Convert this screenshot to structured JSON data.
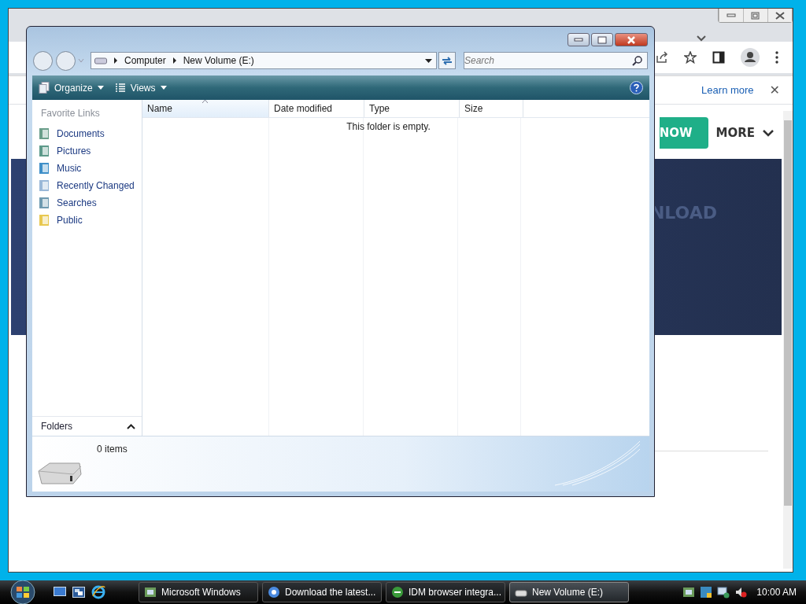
{
  "browser": {
    "info_bar": {
      "link": "Learn more",
      "close": "✕"
    },
    "nav": {
      "cta": "NOW",
      "more": "MORE"
    },
    "banner": {
      "text": "NLOAD"
    }
  },
  "explorer": {
    "breadcrumb": [
      "Computer",
      "New Volume (E:)"
    ],
    "search": {
      "placeholder": "Search"
    },
    "toolbar": [
      {
        "label": "Organize",
        "kind": "organize"
      },
      {
        "label": "Views",
        "kind": "views"
      }
    ],
    "favorites_title": "Favorite Links",
    "favorites": [
      {
        "label": "Documents",
        "kind": "documents"
      },
      {
        "label": "Pictures",
        "kind": "pictures"
      },
      {
        "label": "Music",
        "kind": "music"
      },
      {
        "label": "Recently Changed",
        "kind": "recent"
      },
      {
        "label": "Searches",
        "kind": "searches"
      },
      {
        "label": "Public",
        "kind": "folder"
      }
    ],
    "folders_label": "Folders",
    "columns": [
      {
        "label": "Name",
        "sorted": true
      },
      {
        "label": "Date modified",
        "sorted": false
      },
      {
        "label": "Type",
        "sorted": false
      },
      {
        "label": "Size",
        "sorted": false
      }
    ],
    "empty_message": "This folder is empty.",
    "status": "0 items"
  },
  "taskbar": {
    "tasks": [
      {
        "label": "Microsoft Windows",
        "kind": "app",
        "selected": false
      },
      {
        "label": "Download the latest...",
        "kind": "chrome",
        "selected": false
      },
      {
        "label": "IDM browser integra...",
        "kind": "idm",
        "selected": false
      },
      {
        "label": "New Volume (E:)",
        "kind": "drive",
        "selected": true
      }
    ],
    "clock": "10:00 AM"
  }
}
